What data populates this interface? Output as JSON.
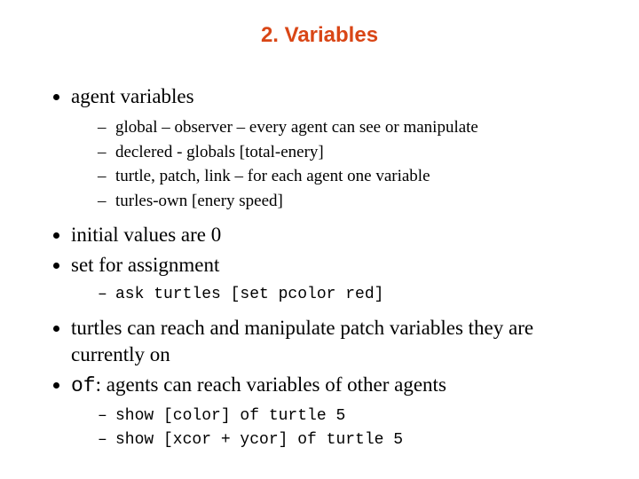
{
  "title": "2. Variables",
  "bullets": {
    "b1": "agent variables",
    "b1_sub": [
      "global – observer – every agent can see or manipulate",
      "declered - globals [total-enery]",
      "turtle, patch, link – for each agent one variable",
      "turles-own [enery speed]"
    ],
    "b2": "initial values are 0",
    "b3": "set for assignment",
    "b3_sub": [
      "ask turtles [set pcolor red]"
    ],
    "b4": "turtles can reach and manipulate patch variables they are currently on",
    "b5_pre": "of",
    "b5_post": ": agents can reach variables of other agents",
    "b5_sub": [
      "show [color] of turtle 5",
      "show [xcor + ycor] of turtle 5"
    ]
  }
}
